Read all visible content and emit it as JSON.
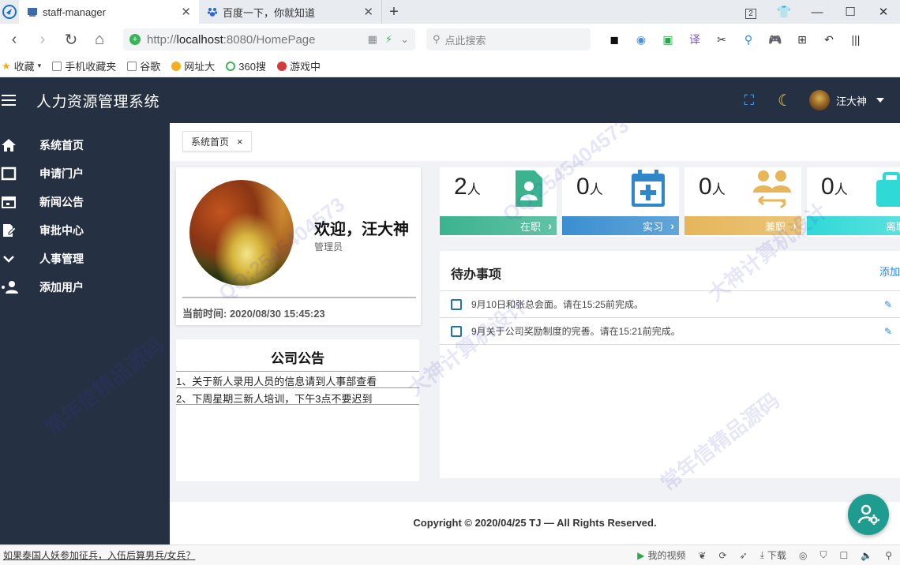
{
  "browser": {
    "tabs": [
      {
        "label": "staff-manager",
        "active": true
      },
      {
        "label": "百度一下，你就知道",
        "active": false
      }
    ],
    "new_tab": "+",
    "tab_count": "2",
    "url_scheme": "http://",
    "url_host": "localhost",
    "url_rest": ":8080/HomePage",
    "search_placeholder": "点此搜索",
    "bookmarks": [
      "收藏",
      "手机收藏夹",
      "谷歌",
      "网址大",
      "360搜",
      "游戏中"
    ]
  },
  "header": {
    "title": "人力资源管理系统",
    "user_name": "汪大神"
  },
  "sidebar": {
    "items": [
      {
        "label": "系统首页",
        "icon": "home-icon"
      },
      {
        "label": "申请门户",
        "icon": "window-icon"
      },
      {
        "label": "新闻公告",
        "icon": "calendar-icon"
      },
      {
        "label": "审批中心",
        "icon": "document-edit-icon"
      },
      {
        "label": "人事管理",
        "icon": "chevron-down-icon"
      },
      {
        "label": "添加用户",
        "icon": "add-user-icon"
      }
    ]
  },
  "page_tab": {
    "label": "系统首页",
    "close": "×"
  },
  "profile": {
    "welcome": "欢迎，汪大神",
    "role": "管理员",
    "time": "当前时间: 2020/08/30 15:45:23"
  },
  "notice": {
    "title": "公司公告",
    "items": [
      "1、关于新人录用人员的信息请到人事部查看",
      "2、下周星期三新人培训，下午3点不要迟到"
    ]
  },
  "stats": [
    {
      "count": "2",
      "unit": "人",
      "label": "在职",
      "color": "#3bb38f"
    },
    {
      "count": "0",
      "unit": "人",
      "label": "实习",
      "color": "#3a8fcf"
    },
    {
      "count": "0",
      "unit": "人",
      "label": "兼职",
      "color": "#e6b659"
    },
    {
      "count": "0",
      "unit": "人",
      "label": "离职",
      "color": "#2fd9d6"
    }
  ],
  "todo": {
    "title": "待办事项",
    "add": "添加",
    "items": [
      "9月10日和张总会面。请在15:25前完成。",
      "9月关于公司奖励制度的完善。请在15:21前完成。"
    ]
  },
  "footer": {
    "text": "Copyright © 2020/04/25 TJ — All Rights Reserved."
  },
  "statusbar": {
    "news": "如果泰国人妖参加征兵，入伍后算男兵/女兵？",
    "video": "我的视频",
    "download": "下载"
  },
  "watermarks": [
    "常年信精品源码",
    "QQ:2545404573",
    "大神计算机设计"
  ]
}
